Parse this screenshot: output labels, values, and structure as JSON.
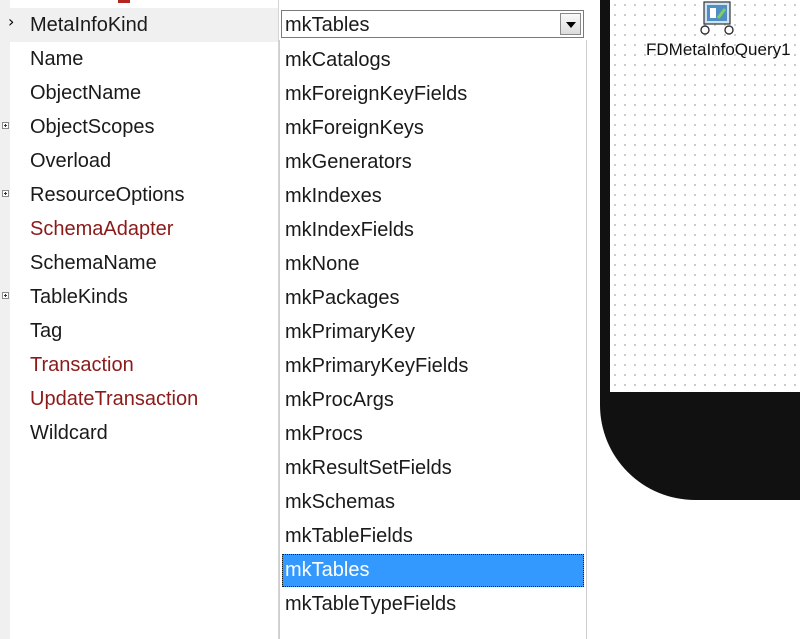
{
  "inspector": {
    "properties": [
      {
        "name": "MetaInfoKind",
        "style": "normal",
        "expandable": false,
        "selected": true
      },
      {
        "name": "Name",
        "style": "normal",
        "expandable": false
      },
      {
        "name": "ObjectName",
        "style": "normal",
        "expandable": false
      },
      {
        "name": "ObjectScopes",
        "style": "normal",
        "expandable": true
      },
      {
        "name": "Overload",
        "style": "normal",
        "expandable": false
      },
      {
        "name": "ResourceOptions",
        "style": "normal",
        "expandable": true
      },
      {
        "name": "SchemaAdapter",
        "style": "red",
        "expandable": false
      },
      {
        "name": "SchemaName",
        "style": "normal",
        "expandable": false
      },
      {
        "name": "TableKinds",
        "style": "normal",
        "expandable": true
      },
      {
        "name": "Tag",
        "style": "normal",
        "expandable": false
      },
      {
        "name": "Transaction",
        "style": "red",
        "expandable": false
      },
      {
        "name": "UpdateTransaction",
        "style": "red",
        "expandable": false
      },
      {
        "name": "Wildcard",
        "style": "normal",
        "expandable": false
      }
    ],
    "current_value": "mkTables",
    "row_marker": "›"
  },
  "dropdown": {
    "options": [
      "mkCatalogs",
      "mkForeignKeyFields",
      "mkForeignKeys",
      "mkGenerators",
      "mkIndexes",
      "mkIndexFields",
      "mkNone",
      "mkPackages",
      "mkPrimaryKey",
      "mkPrimaryKeyFields",
      "mkProcArgs",
      "mkProcs",
      "mkResultSetFields",
      "mkSchemas",
      "mkTableFields",
      "mkTables",
      "mkTableTypeFields"
    ],
    "selected": "mkTables"
  },
  "designer": {
    "component_label": "FDMetaInfoQuery1",
    "component_icon": "metainfo-query-icon"
  },
  "colors": {
    "selection": "#3399ff",
    "red_property": "#8b1a1a",
    "device_frame": "#111111"
  }
}
